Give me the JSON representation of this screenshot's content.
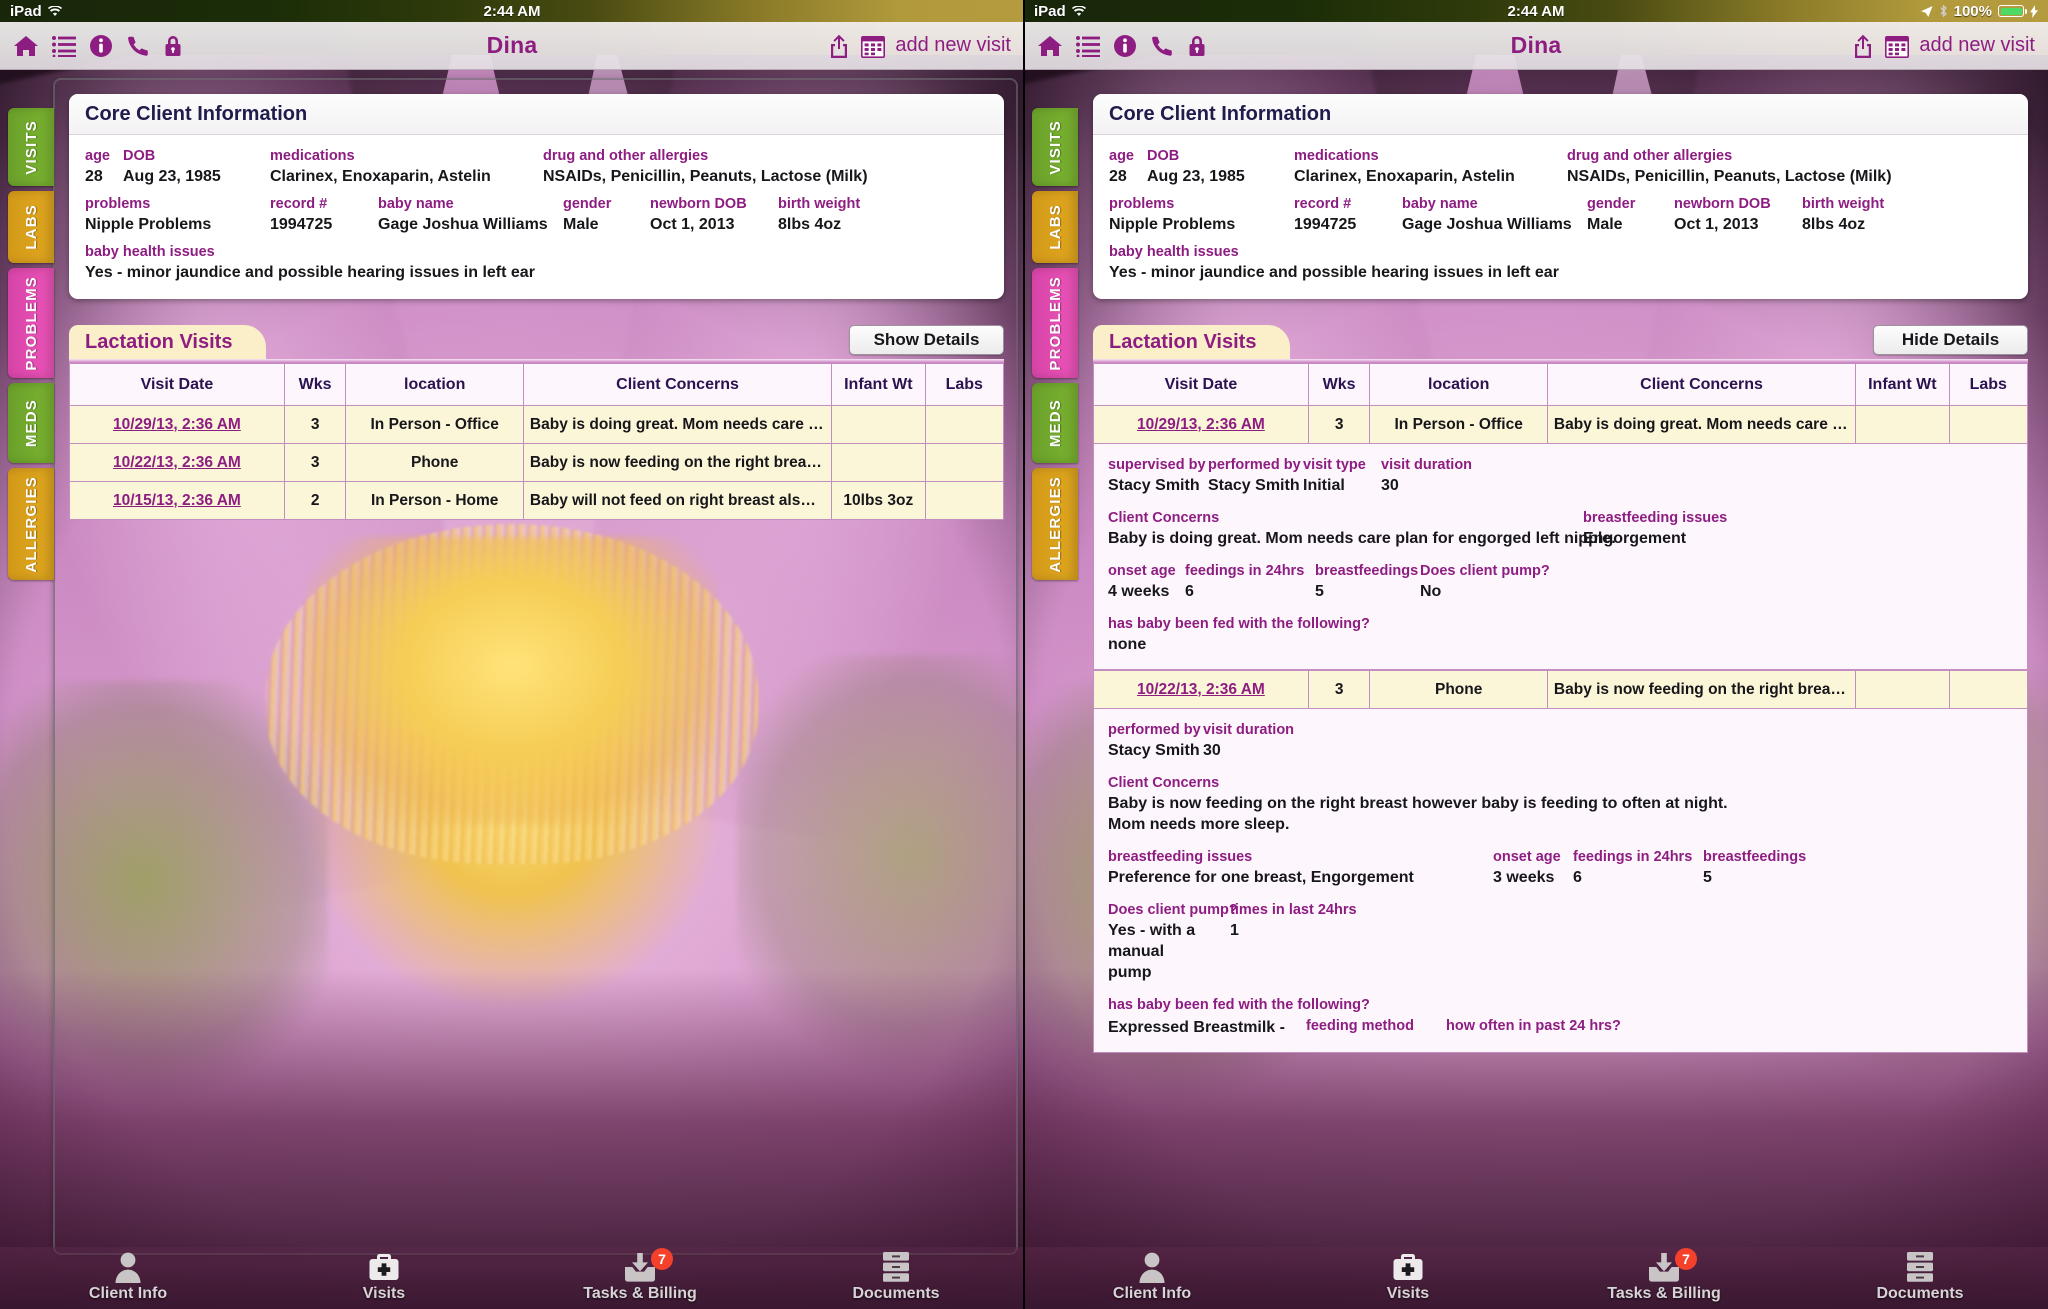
{
  "status_bar": {
    "device": "iPad",
    "wifi_icon": "wifi-icon",
    "time": "2:44 AM",
    "location_icon": "location-arrow-icon",
    "bluetooth_icon": "bluetooth-icon",
    "battery_pct": "100%",
    "charging_icon": "lightning-bolt-icon"
  },
  "nav": {
    "title": "Dina",
    "icons": [
      "home-icon",
      "list-icon",
      "info-icon",
      "phone-icon",
      "lock-icon"
    ],
    "share_icon": "share-icon",
    "calendar_icon": "calendar-icon",
    "add_visit_label": "add new visit"
  },
  "side_tabs": [
    {
      "label": "VISITS",
      "color": "#7cb531"
    },
    {
      "label": "LABS",
      "color": "#e2a81f"
    },
    {
      "label": "PROBLEMS",
      "color": "#ef55bb"
    },
    {
      "label": "MEDS",
      "color": "#7cb531"
    },
    {
      "label": "ALLERGIES",
      "color": "#e2a81f"
    }
  ],
  "core_client": {
    "title": "Core Client Information",
    "row1": [
      {
        "label": "age",
        "value": "28"
      },
      {
        "label": "DOB",
        "value": "Aug 23, 1985"
      },
      {
        "label": "medications",
        "value": "Clarinex, Enoxaparin, Astelin"
      },
      {
        "label": "drug and other allergies",
        "value": "NSAIDs, Penicillin, Peanuts, Lactose (Milk)"
      }
    ],
    "row2": [
      {
        "label": "problems",
        "value": "Nipple Problems"
      },
      {
        "label": "record #",
        "value": "1994725"
      },
      {
        "label": "baby name",
        "value": "Gage Joshua Williams"
      },
      {
        "label": "gender",
        "value": "Male"
      },
      {
        "label": "newborn DOB",
        "value": "Oct 1, 2013"
      },
      {
        "label": "birth weight",
        "value": "8lbs 4oz"
      }
    ],
    "row3": [
      {
        "label": "baby health issues",
        "value": "Yes - minor jaundice and possible hearing issues in left ear"
      }
    ]
  },
  "lactation": {
    "title": "Lactation Visits",
    "toggle_left": "Show Details",
    "toggle_right": "Hide Details",
    "columns": [
      "Visit Date",
      "Wks",
      "location",
      "Client Concerns",
      "Infant Wt",
      "Labs"
    ],
    "rows": [
      {
        "date": "10/29/13, 2:36 AM",
        "wks": "3",
        "location": "In Person - Office",
        "concern": "Baby is doing great. Mom needs care plan fo…",
        "infant_wt": "",
        "labs": ""
      },
      {
        "date": "10/22/13, 2:36 AM",
        "wks": "3",
        "location": "Phone",
        "concern": "Baby is now feeding on the right breast how…",
        "infant_wt": "",
        "labs": ""
      },
      {
        "date": "10/15/13, 2:36 AM",
        "wks": "2",
        "location": "In Person - Home",
        "concern": "Baby will not feed on right breast also baby…",
        "infant_wt": "10lbs 3oz",
        "labs": ""
      }
    ],
    "details": [
      {
        "meta": [
          {
            "label": "supervised by",
            "value": "Stacy Smith"
          },
          {
            "label": "performed by",
            "value": "Stacy Smith"
          },
          {
            "label": "visit type",
            "value": "Initial"
          },
          {
            "label": "visit duration",
            "value": "30"
          }
        ],
        "concerns_label": "Client Concerns",
        "concerns_value": "Baby is doing great. Mom needs care plan for engorged left nipple.",
        "issues_label": "breastfeeding issues",
        "issues_value": "Engorgement",
        "stats": [
          {
            "label": "onset age",
            "value": "4 weeks"
          },
          {
            "label": "feedings in 24hrs",
            "value": "6"
          },
          {
            "label": "breastfeedings",
            "value": "5"
          },
          {
            "label": "Does client pump?",
            "value": "No"
          }
        ],
        "fed_label": "has baby been fed with the following?",
        "fed_value": "none"
      },
      {
        "meta": [
          {
            "label": "performed by",
            "value": "Stacy Smith"
          },
          {
            "label": "visit duration",
            "value": "30"
          }
        ],
        "concerns_label": "Client Concerns",
        "concerns_value": "Baby is now feeding on the right breast however baby is feeding to often at night.  Mom needs more sleep.",
        "issues_label": "breastfeeding issues",
        "issues_value": "Preference for one breast, Engorgement",
        "stats": [
          {
            "label": "onset age",
            "value": "3 weeks"
          },
          {
            "label": "feedings in 24hrs",
            "value": "6"
          },
          {
            "label": "breastfeedings",
            "value": "5"
          }
        ],
        "pump": [
          {
            "label": "Does client pump?",
            "value": "Yes - with a manual pump"
          },
          {
            "label": "times in last 24hrs",
            "value": "1"
          }
        ],
        "fed_label": "has baby been fed with the following?",
        "fed_row": [
          {
            "label": "",
            "value": "Expressed Breastmilk -"
          },
          {
            "label": "feeding method",
            "value": ""
          },
          {
            "label": "how often in past 24 hrs?",
            "value": ""
          }
        ]
      }
    ]
  },
  "tab_bar": [
    {
      "label": "Client Info",
      "icon": "person-icon",
      "badge": ""
    },
    {
      "label": "Visits",
      "icon": "medical-bag-icon",
      "badge": ""
    },
    {
      "label": "Tasks & Billing",
      "icon": "inbox-download-icon",
      "badge": "7"
    },
    {
      "label": "Documents",
      "icon": "file-cabinet-icon",
      "badge": ""
    }
  ],
  "colors": {
    "accent": "#8e1d82",
    "heading": "#1f1b4d",
    "table_border": "#c48fc0",
    "row_bg": "#fcf6d8",
    "badge": "#f5402c",
    "battery": "#4cd964"
  }
}
